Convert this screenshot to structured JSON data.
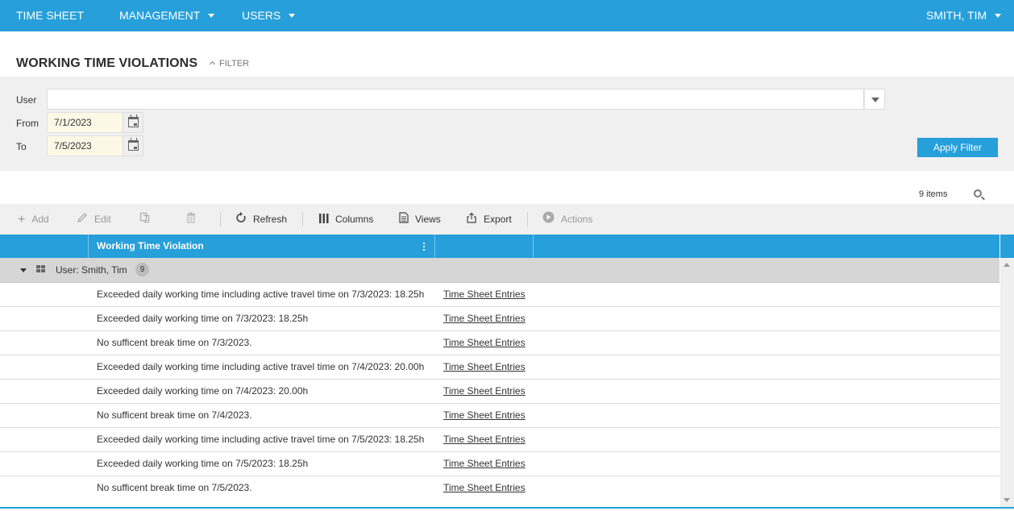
{
  "nav": {
    "items": [
      {
        "label": "TIME SHEET",
        "has_dropdown": false
      },
      {
        "label": "MANAGEMENT",
        "has_dropdown": true
      },
      {
        "label": "USERS",
        "has_dropdown": true
      }
    ],
    "user_menu": "SMITH, TIM"
  },
  "page": {
    "title": "WORKING TIME VIOLATIONS",
    "filter_toggle": "FILTER"
  },
  "filter": {
    "user_label": "User",
    "user_value": "",
    "from_label": "From",
    "from_value": "7/1/2023",
    "to_label": "To",
    "to_value": "7/5/2023",
    "apply_label": "Apply Filter"
  },
  "grid_info": {
    "items_count": "9 items"
  },
  "toolbar": {
    "add": "Add",
    "edit": "Edit",
    "refresh": "Refresh",
    "columns": "Columns",
    "views": "Views",
    "export": "Export",
    "actions": "Actions"
  },
  "grid": {
    "columns": [
      "Working Time Violation",
      "",
      ""
    ],
    "group": {
      "label": "User: Smith, Tim",
      "count": "9"
    },
    "rows": [
      {
        "violation": "Exceeded daily working time including active travel time on 7/3/2023: 18.25h",
        "link": "Time Sheet Entries"
      },
      {
        "violation": "Exceeded daily working time on 7/3/2023: 18.25h",
        "link": "Time Sheet Entries"
      },
      {
        "violation": "No sufficent break time on 7/3/2023.",
        "link": "Time Sheet Entries"
      },
      {
        "violation": "Exceeded daily working time including active travel time on 7/4/2023: 20.00h",
        "link": "Time Sheet Entries"
      },
      {
        "violation": "Exceeded daily working time on 7/4/2023: 20.00h",
        "link": "Time Sheet Entries"
      },
      {
        "violation": "No sufficent break time on 7/4/2023.",
        "link": "Time Sheet Entries"
      },
      {
        "violation": "Exceeded daily working time including active travel time on 7/5/2023: 18.25h",
        "link": "Time Sheet Entries"
      },
      {
        "violation": "Exceeded daily working time on 7/5/2023: 18.25h",
        "link": "Time Sheet Entries"
      },
      {
        "violation": "No sufficent break time on 7/5/2023.",
        "link": "Time Sheet Entries"
      }
    ]
  },
  "colors": {
    "accent": "#269fda",
    "filter_bg": "#f0f0f0",
    "group_bg": "#d7d6d6",
    "date_bg": "#fdf8e6"
  }
}
